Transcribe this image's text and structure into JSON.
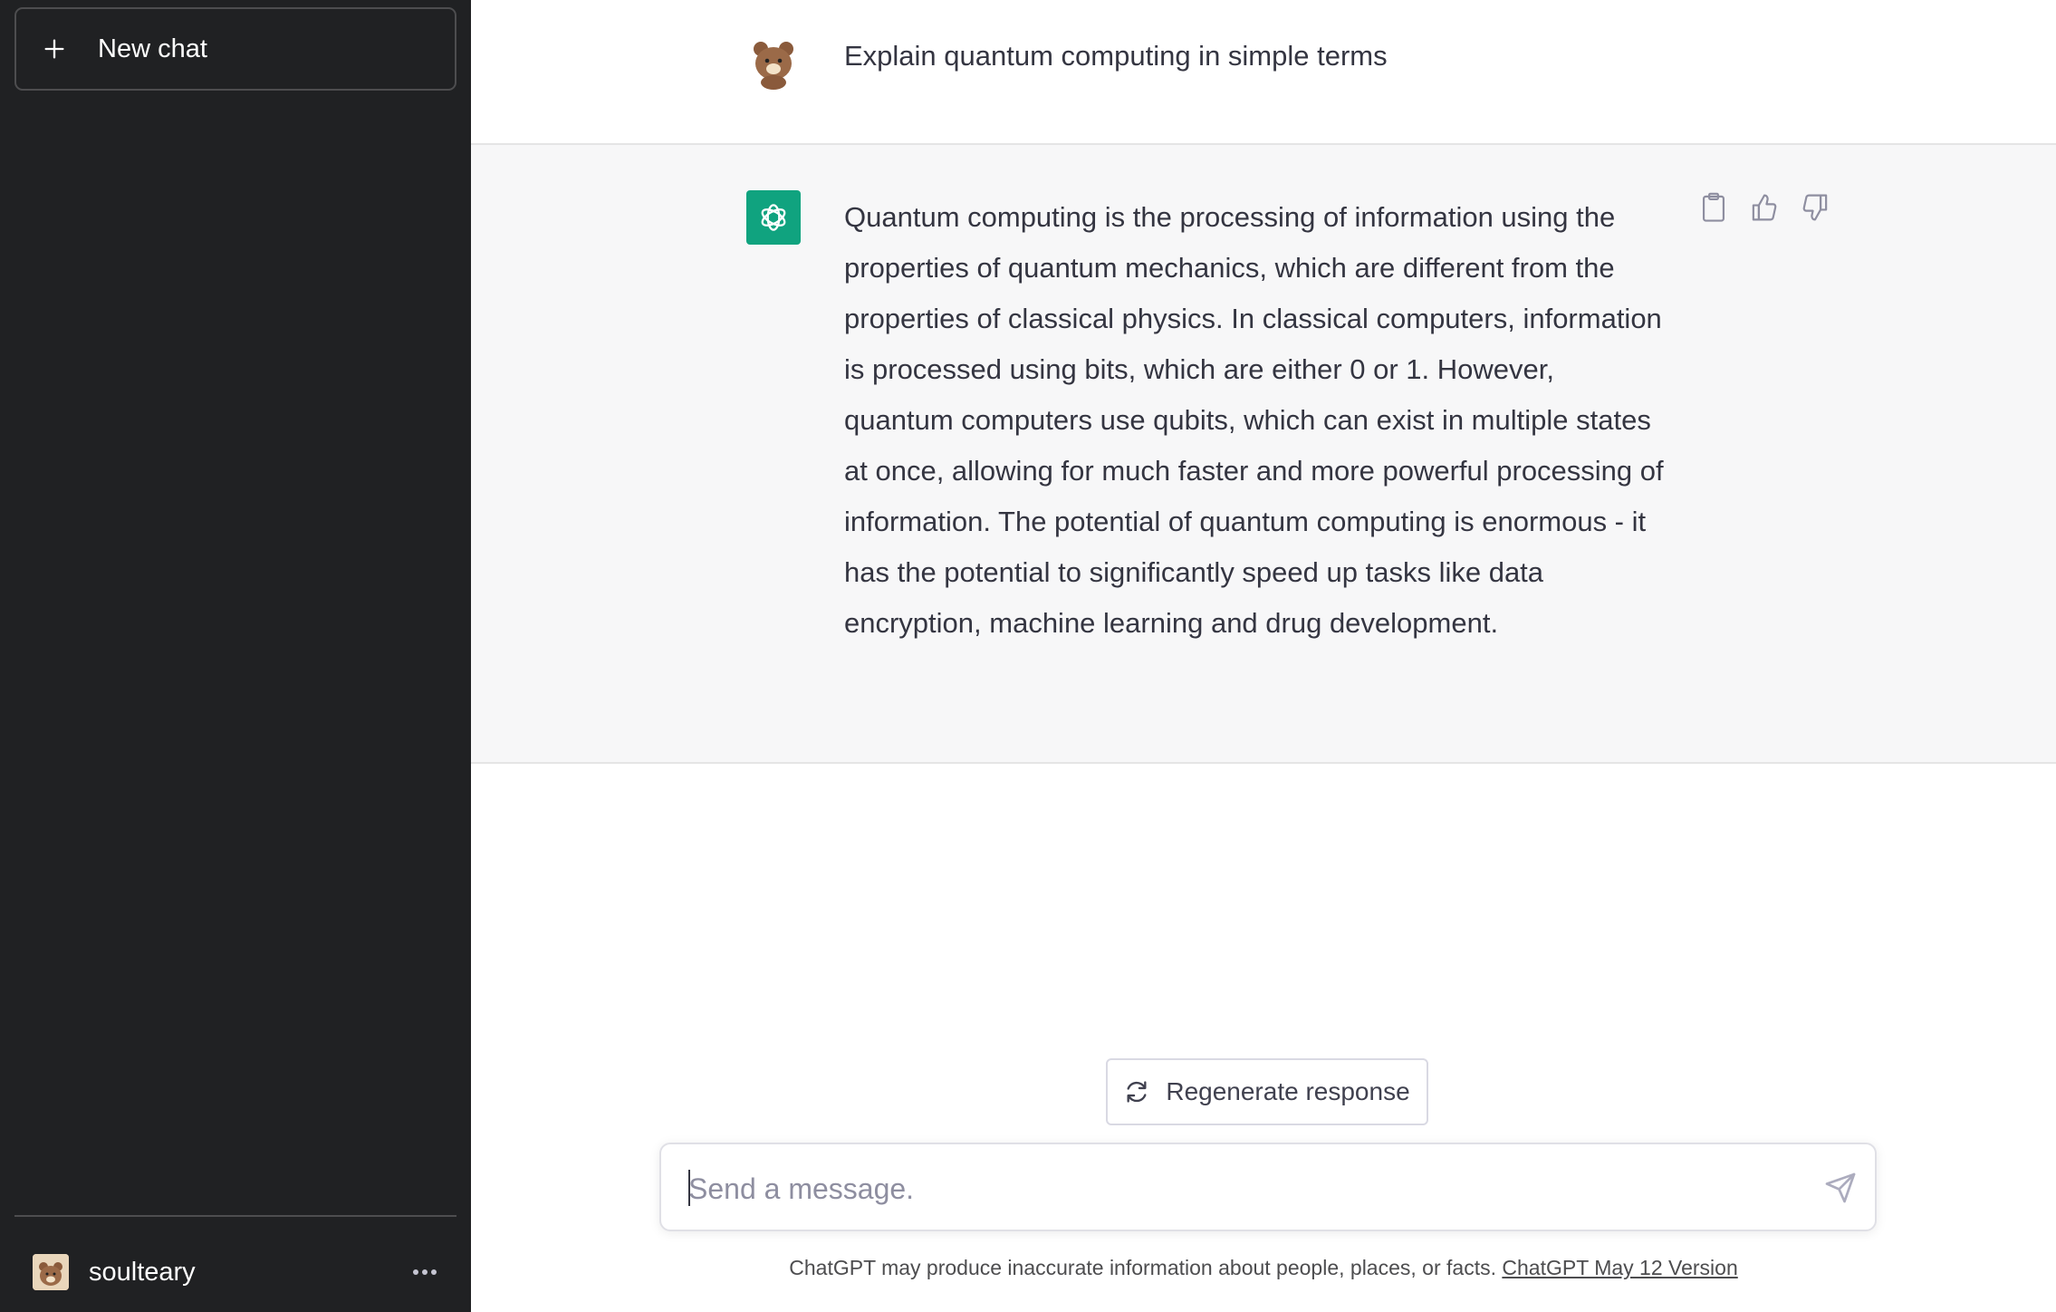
{
  "sidebar": {
    "new_chat_label": "New chat",
    "user": {
      "name": "soulteary"
    }
  },
  "conversation": {
    "user_message": "Explain quantum computing in simple terms",
    "assistant_message": "Quantum computing is the processing of information using the properties of quantum mechanics, which are different from the properties of classical physics. In classical computers, information is processed using bits, which are either 0 or 1. However, quantum computers use qubits, which can exist in multiple states at once, allowing for much faster and more powerful processing of information. The potential of quantum computing is enormous - it has the potential to significantly speed up tasks like data encryption, machine learning and drug development."
  },
  "actions": {
    "regenerate_label": "Regenerate response"
  },
  "composer": {
    "placeholder": "Send a message.",
    "value": ""
  },
  "footer": {
    "disclaimer": "ChatGPT may produce inaccurate information about people, places, or facts.",
    "version_link": "ChatGPT May 12 Version"
  },
  "icons": {
    "new_chat": "plus-icon",
    "more": "more-icon",
    "copy": "clipboard-icon",
    "like": "thumbs-up-icon",
    "dislike": "thumbs-down-icon",
    "regenerate": "refresh-icon",
    "send": "send-icon"
  },
  "colors": {
    "sidebar_bg": "#202123",
    "assistant_bg": "#f7f7f8",
    "gpt_brand": "#10a37f",
    "text": "#343541"
  }
}
